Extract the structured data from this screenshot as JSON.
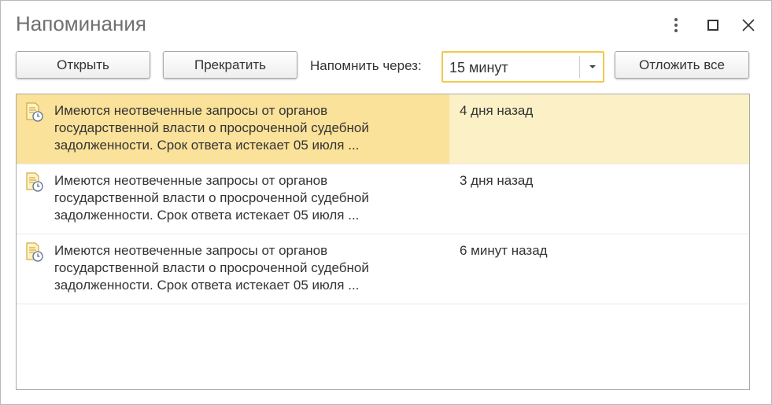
{
  "window": {
    "title": "Напоминания"
  },
  "toolbar": {
    "open_label": "Открыть",
    "stop_label": "Прекратить",
    "remind_label": "Напомнить через:",
    "remind_value": "15 минут",
    "postpone_label": "Отложить все"
  },
  "reminders": [
    {
      "line1": "Имеются неотвеченные запросы от органов",
      "line2": "государственной власти о просроченной судебной",
      "line3": "задолженности. Срок ответа истекает 05 июля ...",
      "time": "4 дня назад",
      "selected": true
    },
    {
      "line1": "Имеются неотвеченные запросы от органов",
      "line2": "государственной власти о просроченной судебной",
      "line3": "задолженности. Срок ответа истекает 05 июля ...",
      "time": "3 дня назад",
      "selected": false
    },
    {
      "line1": "Имеются неотвеченные запросы от органов",
      "line2": "государственной власти о просроченной судебной",
      "line3": "задолженности. Срок ответа истекает 05 июля ...",
      "time": "6 минут назад",
      "selected": false
    }
  ],
  "icons": {
    "more": "more-vertical-icon",
    "maximize": "maximize-icon",
    "close": "close-icon",
    "dropdown": "chevron-down-icon",
    "reminder": "reminder-document-clock-icon"
  },
  "colors": {
    "selected_row": "#fbe29a",
    "selected_row_secondary": "#fcf1c6",
    "select_border": "#f2c94c"
  }
}
